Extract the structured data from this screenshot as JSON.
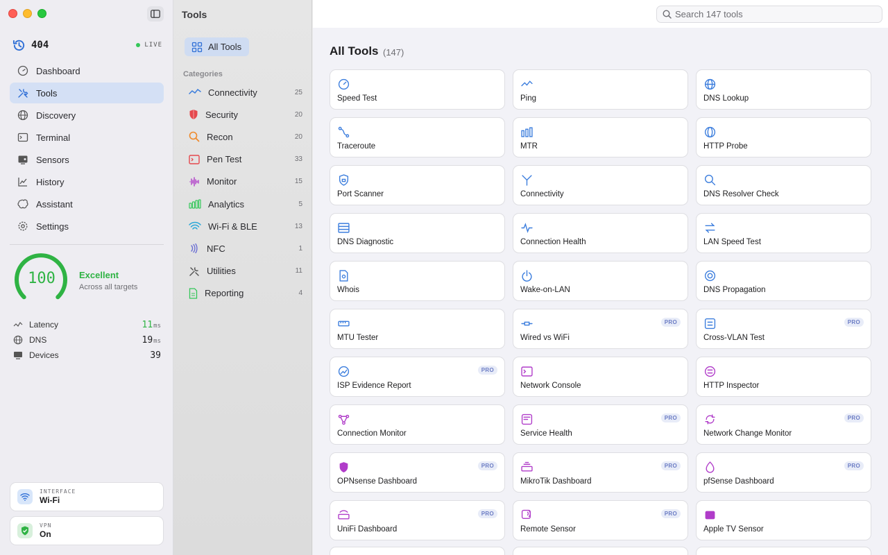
{
  "sidebar": {
    "brand": "404",
    "live": "LIVE",
    "nav": [
      {
        "label": "Dashboard"
      },
      {
        "label": "Tools"
      },
      {
        "label": "Discovery"
      },
      {
        "label": "Terminal"
      },
      {
        "label": "Sensors"
      },
      {
        "label": "History"
      },
      {
        "label": "Assistant"
      },
      {
        "label": "Settings"
      }
    ],
    "active_nav": "Tools",
    "health": {
      "score": "100",
      "score_fraction": 1.0,
      "label": "Excellent",
      "sub": "Across all targets"
    },
    "metrics": [
      {
        "label": "Latency",
        "value": "11",
        "unit": "ms"
      },
      {
        "label": "DNS",
        "value": "19",
        "unit": "ms"
      },
      {
        "label": "Devices",
        "value": "39",
        "unit": ""
      }
    ],
    "interface": {
      "kicker": "INTERFACE",
      "value": "Wi-Fi"
    },
    "vpn": {
      "kicker": "VPN",
      "value": "On"
    }
  },
  "categories": {
    "title": "Tools",
    "all_label": "All Tools",
    "heading": "Categories",
    "items": [
      {
        "label": "Connectivity",
        "count": "25",
        "icon": "wave-icon"
      },
      {
        "label": "Security",
        "count": "20",
        "icon": "shield-icon"
      },
      {
        "label": "Recon",
        "count": "20",
        "icon": "magnifier-icon"
      },
      {
        "label": "Pen Test",
        "count": "33",
        "icon": "terminal-icon"
      },
      {
        "label": "Monitor",
        "count": "15",
        "icon": "waveform-icon"
      },
      {
        "label": "Analytics",
        "count": "5",
        "icon": "bars-icon"
      },
      {
        "label": "Wi-Fi & BLE",
        "count": "13",
        "icon": "wifi-icon"
      },
      {
        "label": "NFC",
        "count": "1",
        "icon": "nfc-icon"
      },
      {
        "label": "Utilities",
        "count": "11",
        "icon": "wrench-icon"
      },
      {
        "label": "Reporting",
        "count": "4",
        "icon": "document-icon"
      }
    ]
  },
  "main": {
    "search_placeholder": "Search 147 tools",
    "title": "All Tools",
    "count": "(147)",
    "pro_label": "PRO",
    "tools": [
      {
        "label": "Speed Test",
        "pro": false,
        "color": "#3b7ddd"
      },
      {
        "label": "Ping",
        "pro": false,
        "color": "#3b7ddd"
      },
      {
        "label": "DNS Lookup",
        "pro": false,
        "color": "#3b7ddd"
      },
      {
        "label": "Traceroute",
        "pro": false,
        "color": "#3b7ddd"
      },
      {
        "label": "MTR",
        "pro": false,
        "color": "#3b7ddd"
      },
      {
        "label": "HTTP Probe",
        "pro": false,
        "color": "#3b7ddd"
      },
      {
        "label": "Port Scanner",
        "pro": false,
        "color": "#3b7ddd"
      },
      {
        "label": "Connectivity",
        "pro": false,
        "color": "#3b7ddd"
      },
      {
        "label": "DNS Resolver Check",
        "pro": false,
        "color": "#3b7ddd"
      },
      {
        "label": "DNS Diagnostic",
        "pro": false,
        "color": "#3b7ddd"
      },
      {
        "label": "Connection Health",
        "pro": false,
        "color": "#3b7ddd"
      },
      {
        "label": "LAN Speed Test",
        "pro": false,
        "color": "#3b7ddd"
      },
      {
        "label": "Whois",
        "pro": false,
        "color": "#3b7ddd"
      },
      {
        "label": "Wake-on-LAN",
        "pro": false,
        "color": "#3b7ddd"
      },
      {
        "label": "DNS Propagation",
        "pro": false,
        "color": "#3b7ddd"
      },
      {
        "label": "MTU Tester",
        "pro": false,
        "color": "#3b7ddd"
      },
      {
        "label": "Wired vs WiFi",
        "pro": true,
        "color": "#3b7ddd"
      },
      {
        "label": "Cross-VLAN Test",
        "pro": true,
        "color": "#3b7ddd"
      },
      {
        "label": "ISP Evidence Report",
        "pro": true,
        "color": "#3b7ddd"
      },
      {
        "label": "Network Console",
        "pro": false,
        "color": "#b03cc9"
      },
      {
        "label": "HTTP Inspector",
        "pro": false,
        "color": "#b03cc9"
      },
      {
        "label": "Connection Monitor",
        "pro": false,
        "color": "#b03cc9"
      },
      {
        "label": "Service Health",
        "pro": true,
        "color": "#b03cc9"
      },
      {
        "label": "Network Change Monitor",
        "pro": true,
        "color": "#b03cc9"
      },
      {
        "label": "OPNsense Dashboard",
        "pro": true,
        "color": "#b03cc9"
      },
      {
        "label": "MikroTik Dashboard",
        "pro": true,
        "color": "#b03cc9"
      },
      {
        "label": "pfSense Dashboard",
        "pro": true,
        "color": "#b03cc9"
      },
      {
        "label": "UniFi Dashboard",
        "pro": true,
        "color": "#b03cc9"
      },
      {
        "label": "Remote Sensor",
        "pro": true,
        "color": "#b03cc9"
      },
      {
        "label": "Apple TV Sensor",
        "pro": false,
        "color": "#b03cc9"
      }
    ]
  },
  "colors": {
    "accent": "#3b7ddd",
    "monitor": "#b03cc9",
    "good": "#2fb344"
  }
}
